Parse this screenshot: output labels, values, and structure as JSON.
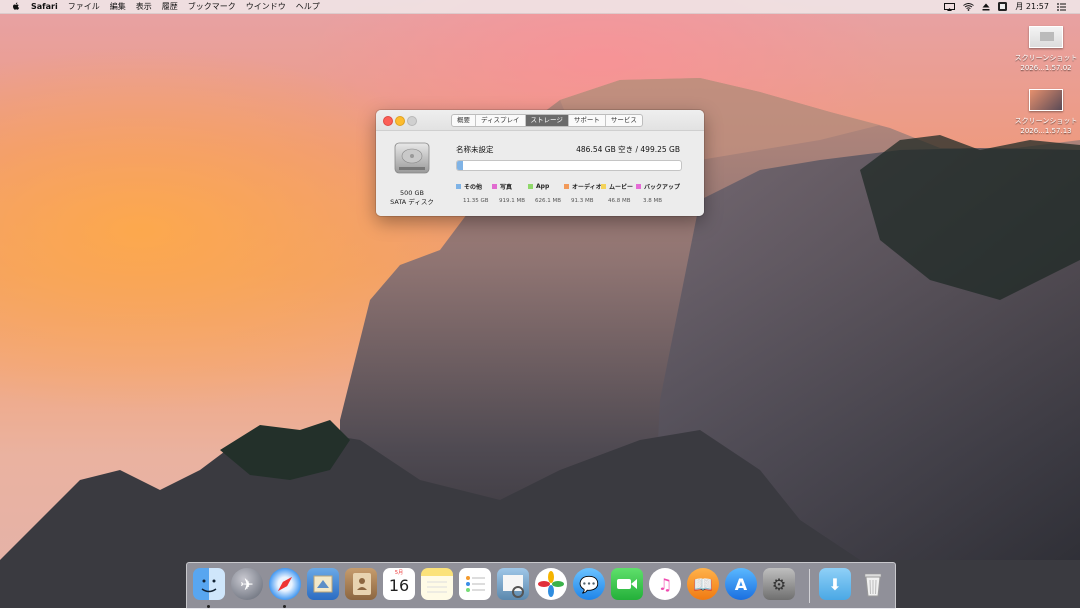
{
  "menubar": {
    "app_name": "Safari",
    "menus": [
      "ファイル",
      "編集",
      "表示",
      "履歴",
      "ブックマーク",
      "ウインドウ",
      "ヘルプ"
    ],
    "clock": "月 21:57"
  },
  "desktop": {
    "files": [
      {
        "name_line1": "スクリーンショット",
        "name_line2": "2026...1.57.02"
      },
      {
        "name_line1": "スクリーンショット",
        "name_line2": "2026...1.57.13"
      }
    ]
  },
  "window": {
    "tabs": [
      "概要",
      "ディスプレイ",
      "ストレージ",
      "サポート",
      "サービス"
    ],
    "active_tab": "ストレージ",
    "disk_capacity": "500 GB",
    "disk_type": "SATA ディスク",
    "volume_name": "名称未設定",
    "free_space": "486.54 GB 空き / 499.25 GB",
    "usage_fraction_used": 0.025,
    "legend": [
      {
        "name": "その他",
        "size": "11.35 GB",
        "color": "#7fb3e6"
      },
      {
        "name": "写真",
        "size": "919.1 MB",
        "color": "#e16bd0"
      },
      {
        "name": "App",
        "size": "626.1 MB",
        "color": "#8fd86a"
      },
      {
        "name": "オーディオ",
        "size": "91.3 MB",
        "color": "#f29a5a"
      },
      {
        "name": "ムービー",
        "size": "46.8 MB",
        "color": "#f4d35a"
      },
      {
        "name": "バックアップ",
        "size": "3.8 MB",
        "color": "#e56bd6"
      }
    ]
  },
  "dock": {
    "apps": [
      {
        "name": "Finder",
        "running": true
      },
      {
        "name": "Launchpad",
        "running": false
      },
      {
        "name": "Safari",
        "running": true
      },
      {
        "name": "Mail",
        "running": false
      },
      {
        "name": "Contacts",
        "running": false
      },
      {
        "name": "Calendar",
        "running": false,
        "date": "16",
        "month": "5月"
      },
      {
        "name": "Notes",
        "running": false
      },
      {
        "name": "Reminders",
        "running": false
      },
      {
        "name": "Preview",
        "running": false
      },
      {
        "name": "Photos",
        "running": false
      },
      {
        "name": "Messages",
        "running": false
      },
      {
        "name": "FaceTime",
        "running": false
      },
      {
        "name": "iTunes",
        "running": false
      },
      {
        "name": "iBooks",
        "running": false
      },
      {
        "name": "App Store",
        "running": false
      },
      {
        "name": "System Preferences",
        "running": false
      }
    ],
    "right_items": [
      "Downloads",
      "Trash"
    ]
  }
}
